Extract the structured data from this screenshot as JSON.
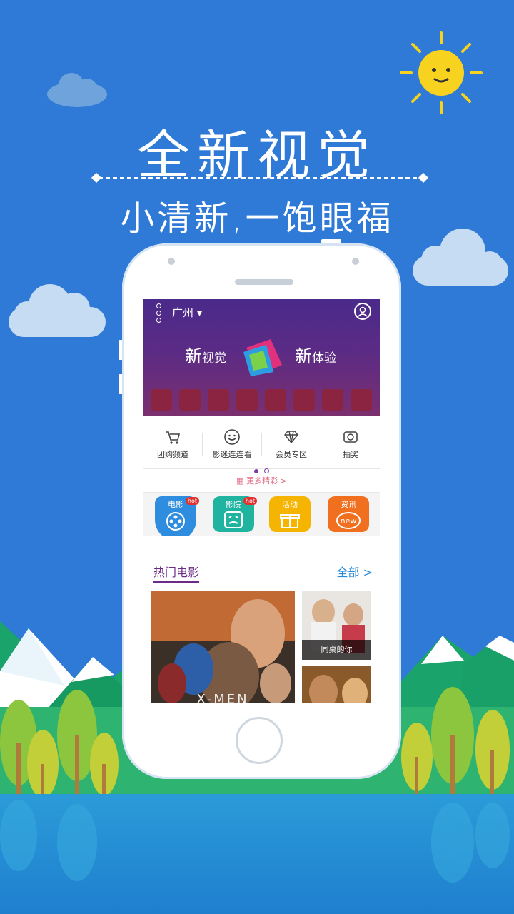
{
  "promo": {
    "headline": "全新视觉",
    "subheadline": "小清新,一饱眼福"
  },
  "app": {
    "city": "广州",
    "banner": {
      "left_big": "新",
      "left_small": "视觉",
      "right_big": "新",
      "right_small": "体验"
    },
    "quick_actions": [
      {
        "label": "团购频道",
        "icon": "cart-icon"
      },
      {
        "label": "影迷连连看",
        "icon": "smiley-icon"
      },
      {
        "label": "会员专区",
        "icon": "diamond-icon"
      },
      {
        "label": "抽奖",
        "icon": "lottery-ticket-icon"
      }
    ],
    "more_link": "更多精彩 >",
    "tabs": [
      {
        "label": "电影",
        "badge": "hot",
        "color": "#2f8de0",
        "icon": "film-reel-icon"
      },
      {
        "label": "影院",
        "badge": "hot",
        "color": "#20b4a0",
        "icon": "cinema-face-icon"
      },
      {
        "label": "活动",
        "badge": "",
        "color": "#f5b400",
        "icon": "gift-icon"
      },
      {
        "label": "资讯",
        "badge": "",
        "color": "#f07020",
        "icon": "new-badge-icon"
      }
    ],
    "section": {
      "title": "热门电影",
      "all_link": "全部 >"
    },
    "movies": [
      {
        "title": "X-MEN"
      },
      {
        "title": "同桌的你"
      }
    ]
  },
  "colors": {
    "sky": "#2f7ad6",
    "accent_purple": "#6b2b86",
    "link_blue": "#2a8ad6"
  }
}
